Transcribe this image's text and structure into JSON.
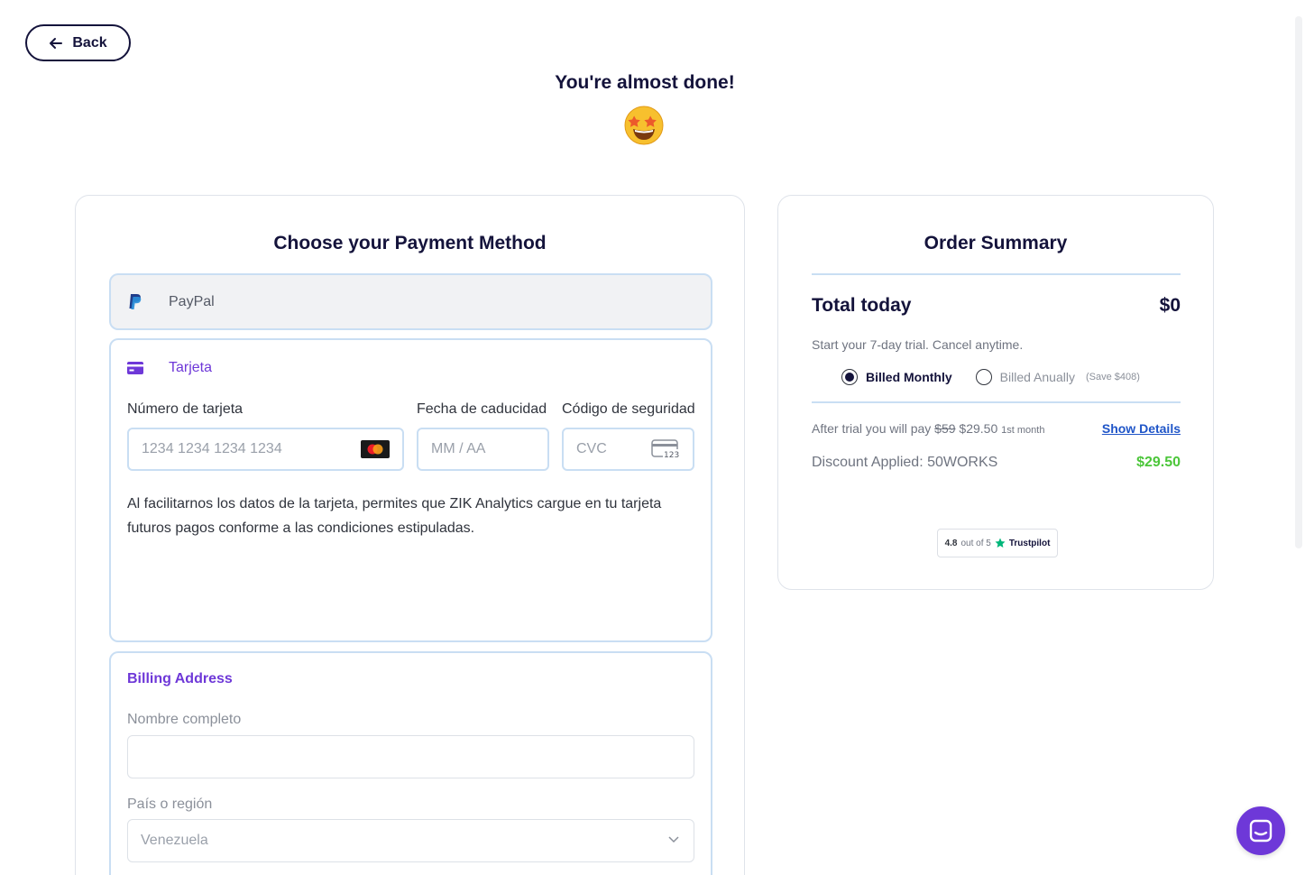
{
  "header": {
    "back_label": "Back",
    "title": "You're almost done!"
  },
  "payment": {
    "title": "Choose your Payment Method",
    "paypal_label": "PayPal",
    "card_label": "Tarjeta",
    "card_number_label": "Número de tarjeta",
    "card_number_placeholder": "1234 1234 1234 1234",
    "expiry_label": "Fecha de caducidad",
    "expiry_placeholder": "MM / AA",
    "cvc_label": "Código de seguridad",
    "cvc_placeholder": "CVC",
    "cvc_icon_text": "123",
    "consent_text": "Al facilitarnos los datos de la tarjeta, permites que ZIK Analytics cargue en tu tarjeta futuros pagos conforme a las condiciones estipuladas."
  },
  "billing": {
    "title": "Billing Address",
    "name_label": "Nombre completo",
    "country_label": "País o región",
    "country_value": "Venezuela"
  },
  "summary": {
    "title": "Order Summary",
    "total_label": "Total today",
    "total_value": "$0",
    "trial_text": "Start your 7-day trial. Cancel anytime.",
    "option_monthly": "Billed Monthly",
    "option_annually": "Billed Anually",
    "option_annually_save": "(Save $408)",
    "after_trial_prefix": "After trial you will pay",
    "old_price": "$59",
    "new_price": "$29.50",
    "first_month": "1st month",
    "show_details": "Show Details",
    "discount_label": "Discount Applied: 50WORKS",
    "discount_value": "$29.50"
  },
  "trustpilot": {
    "rating": "4.8",
    "out_of": "out of 5",
    "brand": "Trustpilot"
  },
  "colors": {
    "accent": "#6e38d8",
    "brand_dark": "#14133b",
    "success": "#4cc63a",
    "link": "#1f55c8"
  },
  "icons": [
    "arrow-left-icon",
    "star-struck-emoji",
    "paypal-icon",
    "credit-card-icon",
    "mastercard-icon",
    "cvc-card-icon",
    "chevron-down-icon",
    "trustpilot-star-icon",
    "chat-icon"
  ]
}
